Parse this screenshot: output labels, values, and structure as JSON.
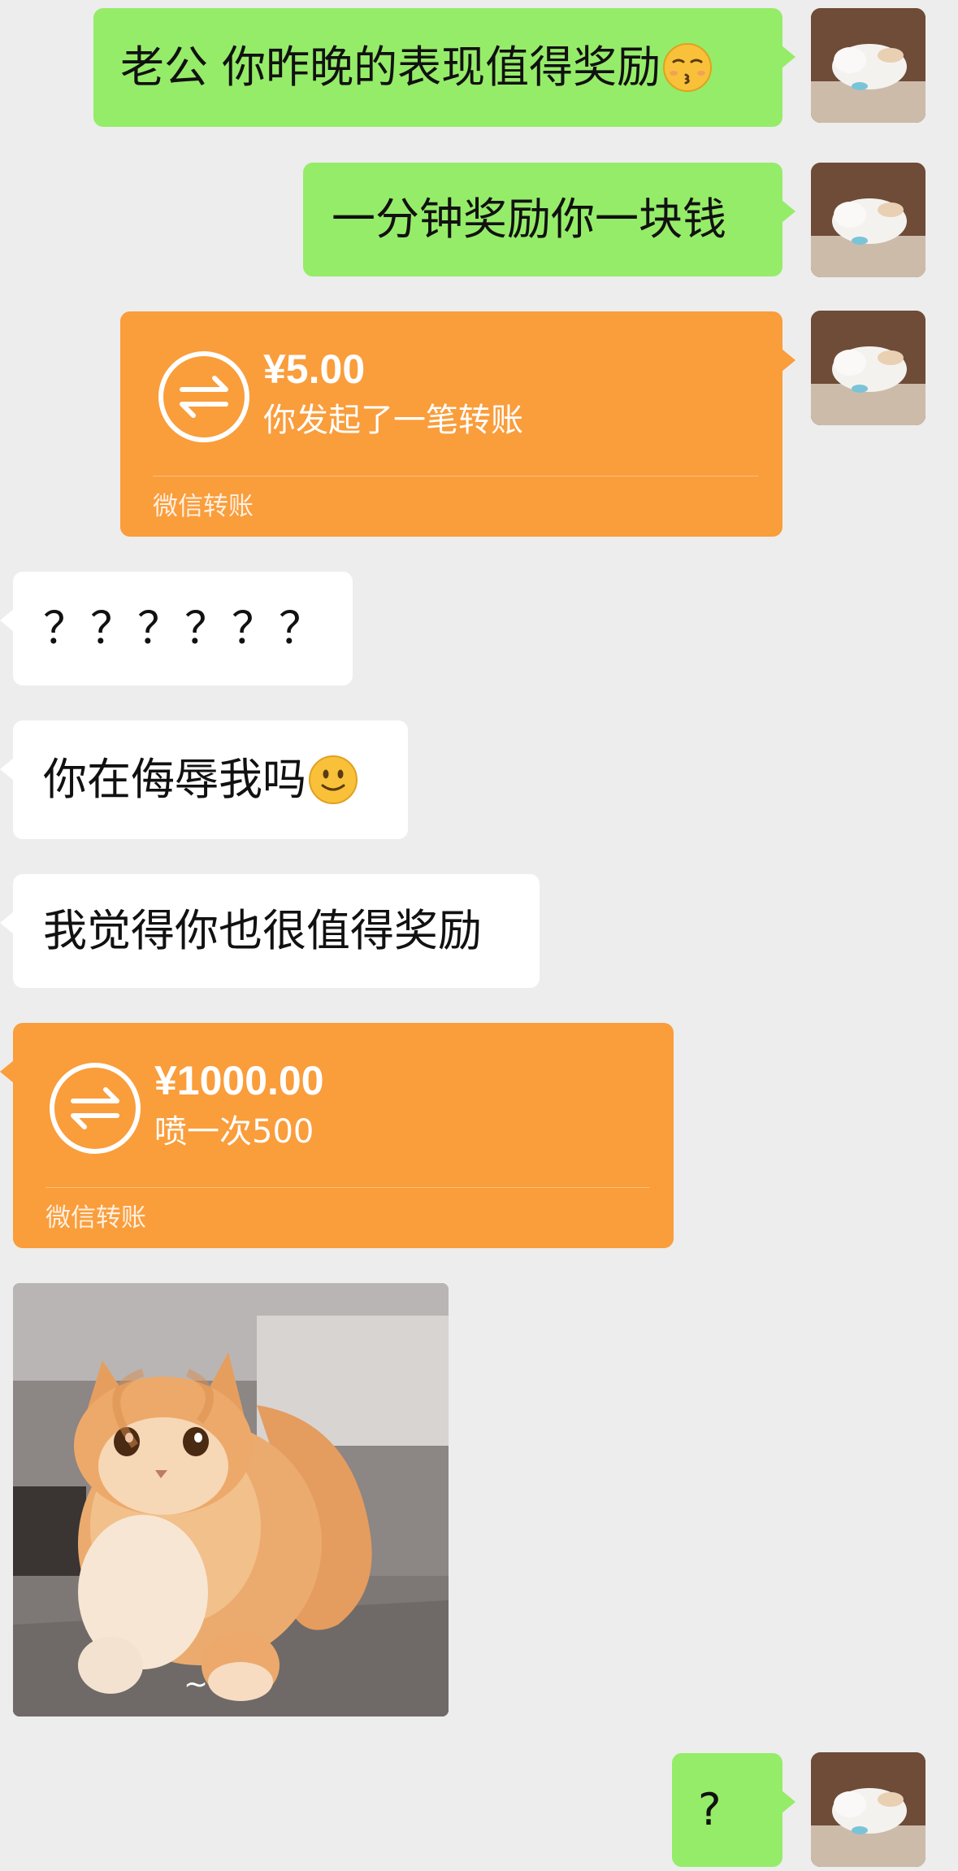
{
  "messages": [
    {
      "text": "老公 你昨晚的表现值得奖励"
    },
    {
      "text": "一分钟奖励你一块钱"
    },
    {
      "amount": "¥5.00",
      "description": "你发起了一笔转账",
      "footer": "微信转账"
    },
    {
      "text": "？？？？？？"
    },
    {
      "text": "你在侮辱我吗"
    },
    {
      "text": "我觉得你也很值得奖励"
    },
    {
      "amount": "¥1000.00",
      "description": "喷一次500",
      "footer": "微信转账"
    },
    {
      "sticker_caption": "~"
    },
    {
      "text": "?"
    }
  ],
  "colors": {
    "background": "#ededed",
    "self_bubble": "#95ec69",
    "other_bubble": "#ffffff",
    "transfer": "#fa9d3b"
  },
  "icons": [
    "kissing-emoji-icon",
    "slight-smile-emoji-icon",
    "transfer-arrows-icon",
    "cat-avatar",
    "cat-sticker"
  ]
}
